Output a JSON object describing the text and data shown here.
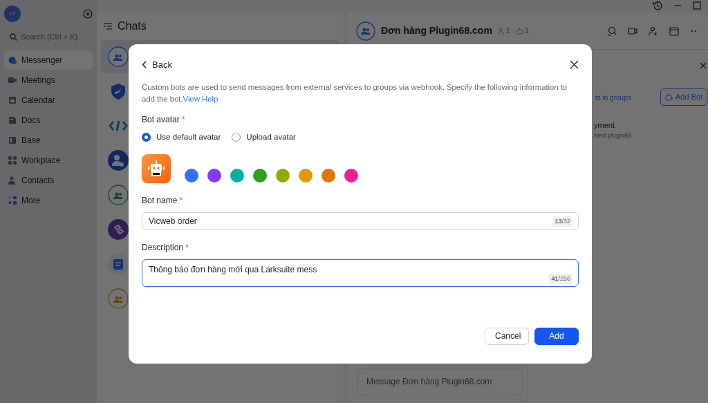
{
  "sidebar": {
    "avatar": "LT",
    "search": {
      "placeholder": "Search (Ctrl + K)"
    },
    "items": [
      {
        "label": "Messenger",
        "selected": true
      },
      {
        "label": "Meetings",
        "selected": false
      },
      {
        "label": "Calendar",
        "selected": false
      },
      {
        "label": "Docs",
        "selected": false
      },
      {
        "label": "Base",
        "selected": false
      },
      {
        "label": "Workplace",
        "selected": false
      },
      {
        "label": "Contacts",
        "selected": false
      },
      {
        "label": "More",
        "selected": false
      }
    ]
  },
  "chats": {
    "title": "Chats",
    "items": [
      {
        "selected": true
      },
      {
        "selected": false
      },
      {
        "selected": false
      },
      {
        "selected": false
      },
      {
        "selected": false
      },
      {
        "selected": false
      },
      {
        "selected": false
      },
      {
        "selected": false
      }
    ]
  },
  "conversation": {
    "title": "Đơn hàng Plugin68.com",
    "member_count": "1",
    "bot_count": "1",
    "message_placeholder": "Message Đơn hàng Plugin68.com"
  },
  "bot_panel": {
    "link": "ts in groups",
    "add_button": "Add Bot",
    "bot_name": "yment",
    "bot_description": "nent plugin68"
  },
  "dialog": {
    "back": "Back",
    "intro": "Custom bots are used to send messages from external services to groups via webhook. Specify the following information to add the bot.",
    "help_link": "View Help",
    "avatar_label": "Bot avatar",
    "required_mark": "*",
    "avatar_options": [
      {
        "label": "Use default avatar",
        "selected": true
      },
      {
        "label": "Upload avatar",
        "selected": false
      }
    ],
    "avatar_colors": [
      {
        "color": "#3370ff"
      },
      {
        "color": "#7f3bf5"
      },
      {
        "color": "#00b2a0"
      },
      {
        "color": "#2ea121"
      },
      {
        "color": "#8fac02"
      },
      {
        "color": "#dc9b04"
      },
      {
        "color": "#de7802"
      },
      {
        "color": "#f01d94"
      }
    ],
    "name_field": {
      "label": "Bot name",
      "value": "Vicweb order",
      "counter": "**13**/32"
    },
    "description_field": {
      "label": "Description",
      "value": "Thông báo đơn hàng mới qua Larksuite mess",
      "counter": "**41**/256",
      "focused": true
    },
    "buttons": [
      {
        "label": "Cancel",
        "kind": "secondary"
      },
      {
        "label": "Add",
        "kind": "primary"
      }
    ]
  }
}
